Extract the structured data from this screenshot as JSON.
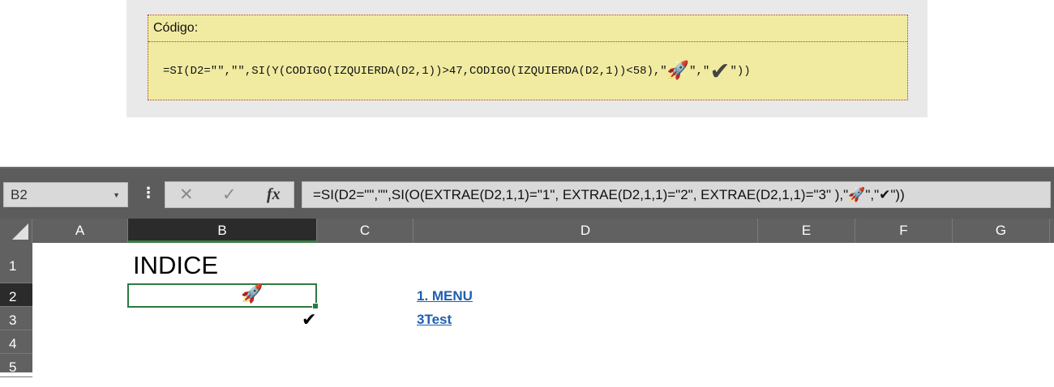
{
  "code_block": {
    "header": "Código:",
    "formula_start": "=SI(D2=\"\",\"\",SI(Y(CODIGO(IZQUIERDA(D2,1))>47,CODIGO(IZQUIERDA(D2,1))<58),\"",
    "rocket": "🚀",
    "formula_mid": "\",\"",
    "check": "✔",
    "formula_end": "\"))"
  },
  "excel": {
    "name_box": "B2",
    "formula_bar": "=SI(D2=\"\",\"\",SI(O(EXTRAE(D2,1,1)=\"1\", EXTRAE(D2,1,1)=\"2\", EXTRAE(D2,1,1)=\"3\" ),\"🚀\",\"✔\"))",
    "columns": [
      "A",
      "B",
      "C",
      "D",
      "E",
      "F",
      "G"
    ],
    "selected_column": "B",
    "rows": [
      "1",
      "2",
      "3",
      "4",
      "5"
    ],
    "selected_row": "2",
    "cells": {
      "B1": "INDICE",
      "B2": "🚀",
      "B3": "✔",
      "D2": "1. MENU",
      "D3": "3Test"
    }
  },
  "icons": {
    "cancel": "cancel-icon",
    "enter": "check-icon",
    "function": "fx-icon"
  },
  "colors": {
    "code_bg": "#f1eba1",
    "selection": "#2d7a3e",
    "link": "#1f5fb0"
  }
}
